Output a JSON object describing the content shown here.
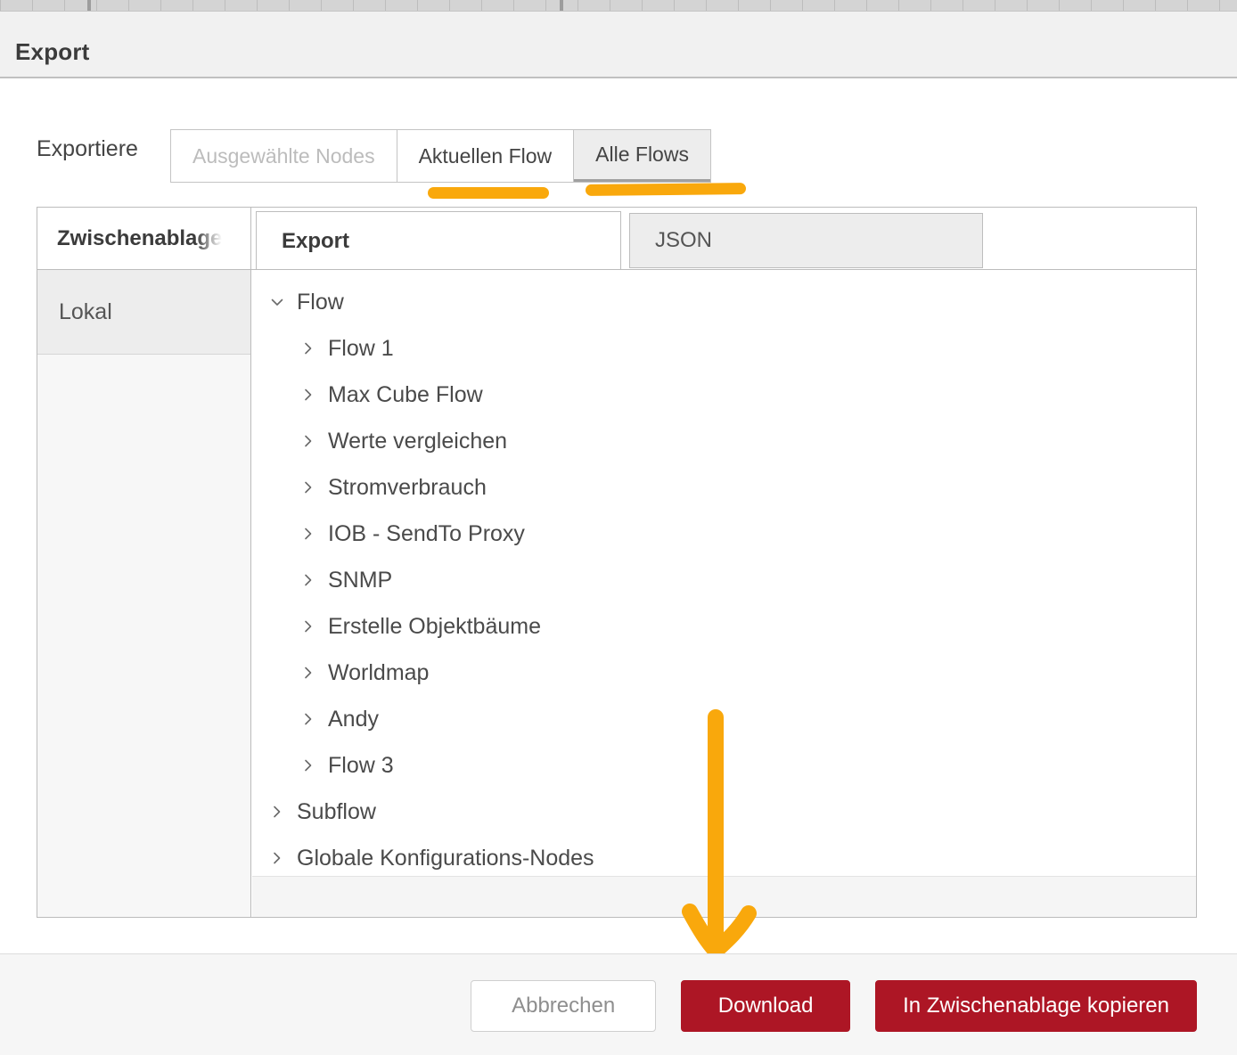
{
  "window": {
    "title": "Export"
  },
  "export_row": {
    "label": "Exportiere",
    "options": [
      {
        "label": "Ausgewählte Nodes",
        "state": "disabled"
      },
      {
        "label": "Aktuellen Flow",
        "state": "normal"
      },
      {
        "label": "Alle Flows",
        "state": "selected"
      }
    ]
  },
  "panel": {
    "tabs": [
      {
        "label": "Zwischenablage",
        "state": "active-truncated"
      },
      {
        "label": "Export",
        "state": "active"
      },
      {
        "label": "JSON",
        "state": "inactive"
      }
    ],
    "side_list": {
      "items": [
        {
          "label": "Lokal",
          "selected": true
        }
      ]
    },
    "tree": {
      "items": [
        {
          "label": "Flow",
          "level": 0,
          "expanded": true
        },
        {
          "label": "Flow 1",
          "level": 1,
          "expanded": false
        },
        {
          "label": "Max Cube Flow",
          "level": 1,
          "expanded": false
        },
        {
          "label": "Werte vergleichen",
          "level": 1,
          "expanded": false
        },
        {
          "label": "Stromverbrauch",
          "level": 1,
          "expanded": false
        },
        {
          "label": "IOB - SendTo Proxy",
          "level": 1,
          "expanded": false
        },
        {
          "label": "SNMP",
          "level": 1,
          "expanded": false
        },
        {
          "label": "Erstelle Objektbäume",
          "level": 1,
          "expanded": false
        },
        {
          "label": "Worldmap",
          "level": 1,
          "expanded": false
        },
        {
          "label": "Andy",
          "level": 1,
          "expanded": false
        },
        {
          "label": "Flow 3",
          "level": 1,
          "expanded": false
        },
        {
          "label": "Subflow",
          "level": 0,
          "expanded": false
        },
        {
          "label": "Globale Konfigurations-Nodes",
          "level": 0,
          "expanded": false
        }
      ]
    }
  },
  "footer": {
    "cancel_label": "Abbrechen",
    "download_label": "Download",
    "copy_label": "In Zwischenablage kopieren"
  },
  "annotations": {
    "highlight_color": "#f9a80c",
    "arrow_color": "#f9a80c",
    "underline_1_target": "Aktuellen Flow",
    "underline_2_target": "Alle Flows",
    "arrow_target": "Download"
  },
  "colors": {
    "primary_button": "#ad1625",
    "header_background": "#f1f1f1",
    "accent_orange": "#f9a80c"
  }
}
